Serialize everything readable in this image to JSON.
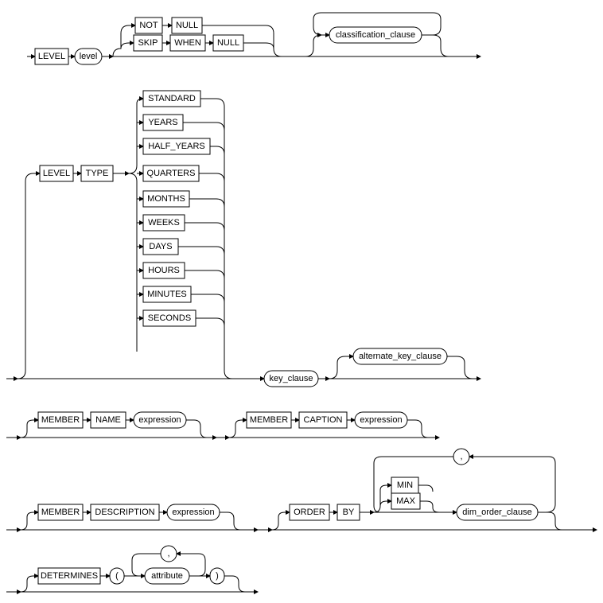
{
  "domain": "Diagram",
  "description": "Railroad/syntax diagram for SQL dimension level clause",
  "tokens": {
    "level_kw": "LEVEL",
    "level_nt": "level",
    "not_kw": "NOT",
    "null_kw": "NULL",
    "skip_kw": "SKIP",
    "when_kw": "WHEN",
    "classification_clause": "classification_clause",
    "type_kw": "TYPE",
    "time_types": {
      "standard": "STANDARD",
      "years": "YEARS",
      "half_years": "HALF_YEARS",
      "quarters": "QUARTERS",
      "months": "MONTHS",
      "weeks": "WEEKS",
      "days": "DAYS",
      "hours": "HOURS",
      "minutes": "MINUTES",
      "seconds": "SECONDS"
    },
    "key_clause": "key_clause",
    "alternate_key_clause": "alternate_key_clause",
    "member_kw": "MEMBER",
    "name_kw": "NAME",
    "caption_kw": "CAPTION",
    "description_kw": "DESCRIPTION",
    "expression": "expression",
    "order_kw": "ORDER",
    "by_kw": "BY",
    "min_kw": "MIN",
    "max_kw": "MAX",
    "dim_order_clause": "dim_order_clause",
    "comma": ",",
    "determines_kw": "DETERMINES",
    "lparen": "(",
    "rparen": ")",
    "attribute": "attribute"
  }
}
